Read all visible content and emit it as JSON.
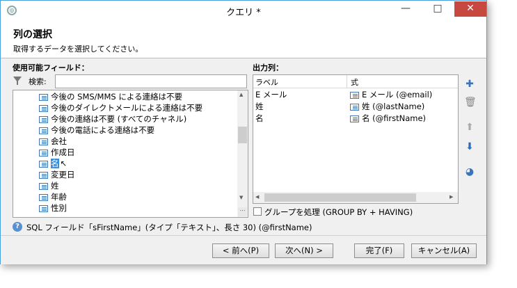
{
  "window": {
    "title": "クエリ *",
    "minimize": "—",
    "maximize": "□",
    "close": "✕"
  },
  "header": {
    "title": "列の選択",
    "subtitle": "取得するデータを選択してください。"
  },
  "available": {
    "label": "使用可能フィールド：",
    "search_label": "検索:",
    "search_value": "",
    "items": [
      {
        "label": "今後の SMS/MMS による連絡は不要"
      },
      {
        "label": "今後のダイレクトメールによる連絡は不要"
      },
      {
        "label": "今後の連絡は不要 (すべてのチャネル)"
      },
      {
        "label": "今後の電話による連絡は不要"
      },
      {
        "label": "会社"
      },
      {
        "label": "作成日"
      },
      {
        "label": "名"
      },
      {
        "label": "変更日"
      },
      {
        "label": "姓"
      },
      {
        "label": "年齢"
      },
      {
        "label": "性別"
      }
    ],
    "selected_index": 6
  },
  "output": {
    "label": "出力列：",
    "col_label": "ラベル",
    "col_expr": "式",
    "rows": [
      {
        "label": "E メール",
        "expr": "E メール (@email)"
      },
      {
        "label": "姓",
        "expr": "姓 (@lastName)"
      },
      {
        "label": "名",
        "expr": "名 (@firstName)"
      }
    ]
  },
  "groupby": {
    "label": "グループを処理 (GROUP BY + HAVING)",
    "checked": false
  },
  "help": {
    "text": "SQL フィールド「sFirstName」(タイプ「テキスト」、長さ 30) (@firstName)"
  },
  "buttons": {
    "back": "< 前へ(P)",
    "next": "次へ(N) >",
    "finish": "完了(F)",
    "cancel": "キャンセル(A)"
  },
  "colors": {
    "accent": "#3a8fdc",
    "close": "#c7483f",
    "icon_blue": "#3b74b8"
  }
}
